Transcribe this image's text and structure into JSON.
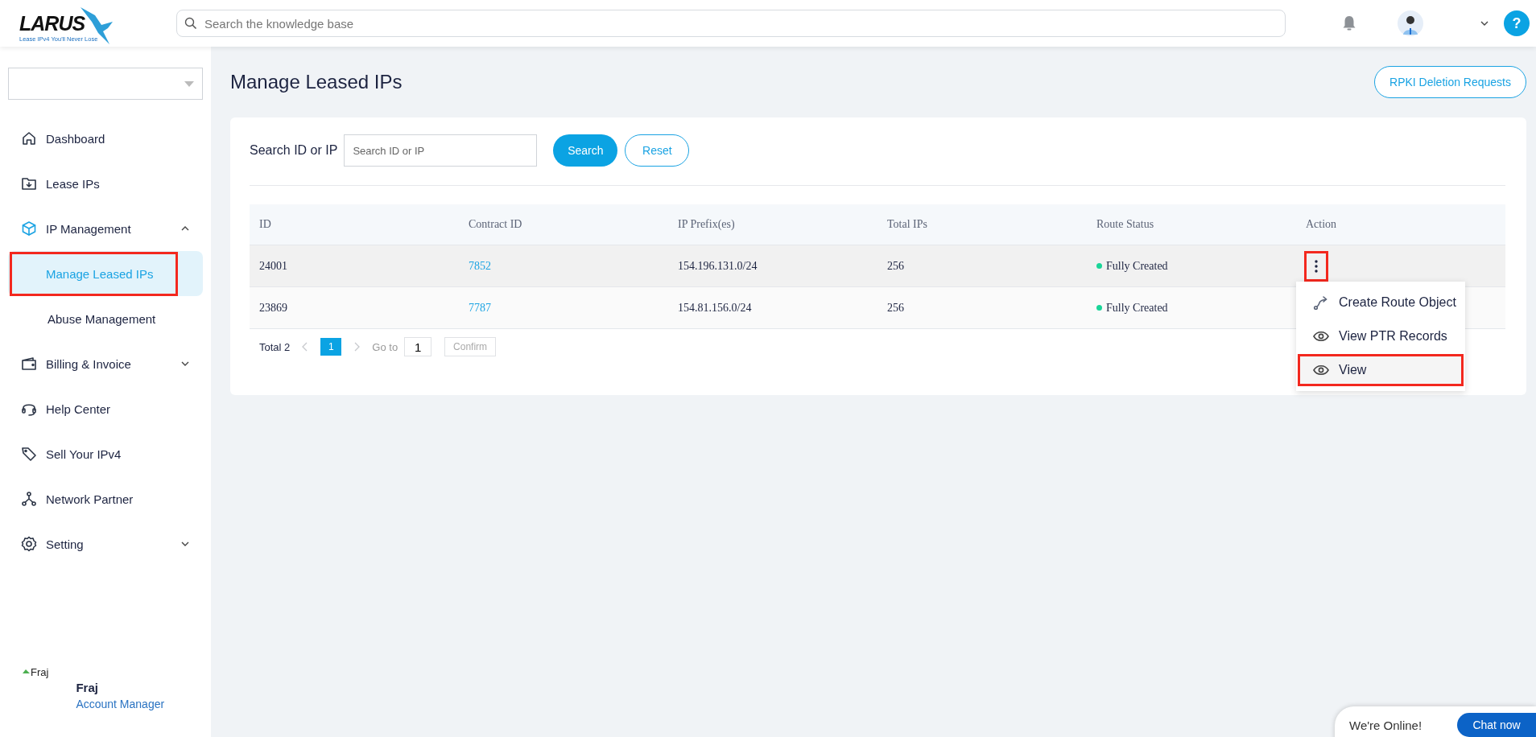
{
  "header": {
    "logo": {
      "name": "LARUS",
      "tagline": "Lease IPv4 You'll Never Lose"
    },
    "search": {
      "placeholder": "Search the knowledge base"
    },
    "help": "?"
  },
  "sidebar": {
    "items": [
      {
        "label": "Dashboard",
        "selected": false
      },
      {
        "label": "Lease IPs",
        "selected": false
      },
      {
        "label": "IP Management",
        "selected": false,
        "expanded": true,
        "children": [
          {
            "label": "Manage Leased IPs",
            "selected": true,
            "highlighted": true
          },
          {
            "label": "Abuse Management",
            "selected": false,
            "highlighted": false
          }
        ]
      },
      {
        "label": "Billing & Invoice",
        "selected": false,
        "expanded": false
      },
      {
        "label": "Help Center",
        "selected": false
      },
      {
        "label": "Sell Your IPv4",
        "selected": false
      },
      {
        "label": "Network Partner",
        "selected": false
      },
      {
        "label": "Setting",
        "selected": false,
        "expanded": false
      }
    ],
    "user": {
      "image_alt": "Fraj",
      "name": "Fraj",
      "role": "Account Manager"
    }
  },
  "page": {
    "title": "Manage Leased IPs",
    "rpki_button": "RPKI Deletion Requests"
  },
  "filter": {
    "label": "Search ID or IP",
    "placeholder": "Search ID or IP",
    "search_button": "Search",
    "reset_button": "Reset"
  },
  "table": {
    "columns": [
      "ID",
      "Contract ID",
      "IP Prefix(es)",
      "Total IPs",
      "Route Status",
      "Action"
    ],
    "rows": [
      {
        "id": "24001",
        "contract_id": "7852",
        "prefix": "154.196.131.0/24",
        "total": "256",
        "status": "Fully Created",
        "color": "#1ad598",
        "hovered": true,
        "menu_open": true,
        "highlighted": true
      },
      {
        "id": "23869",
        "contract_id": "7787",
        "prefix": "154.81.156.0/24",
        "total": "256",
        "status": "Fully Created",
        "color": "#1ad598",
        "menu_open": false
      }
    ]
  },
  "action_menu": [
    {
      "label": "Create Route Object",
      "kind": "route",
      "highlighted": false
    },
    {
      "label": "View PTR Records",
      "kind": "view",
      "highlighted": false
    },
    {
      "label": "View",
      "kind": "view",
      "highlighted": true
    }
  ],
  "pagination": {
    "total": "Total 2",
    "pages": [
      {
        "label": "1",
        "selected": true
      }
    ],
    "goto_label": "Go to",
    "goto_value": "1",
    "confirm": "Confirm"
  },
  "chat": {
    "status": "We're Online!",
    "button": "Chat now"
  }
}
